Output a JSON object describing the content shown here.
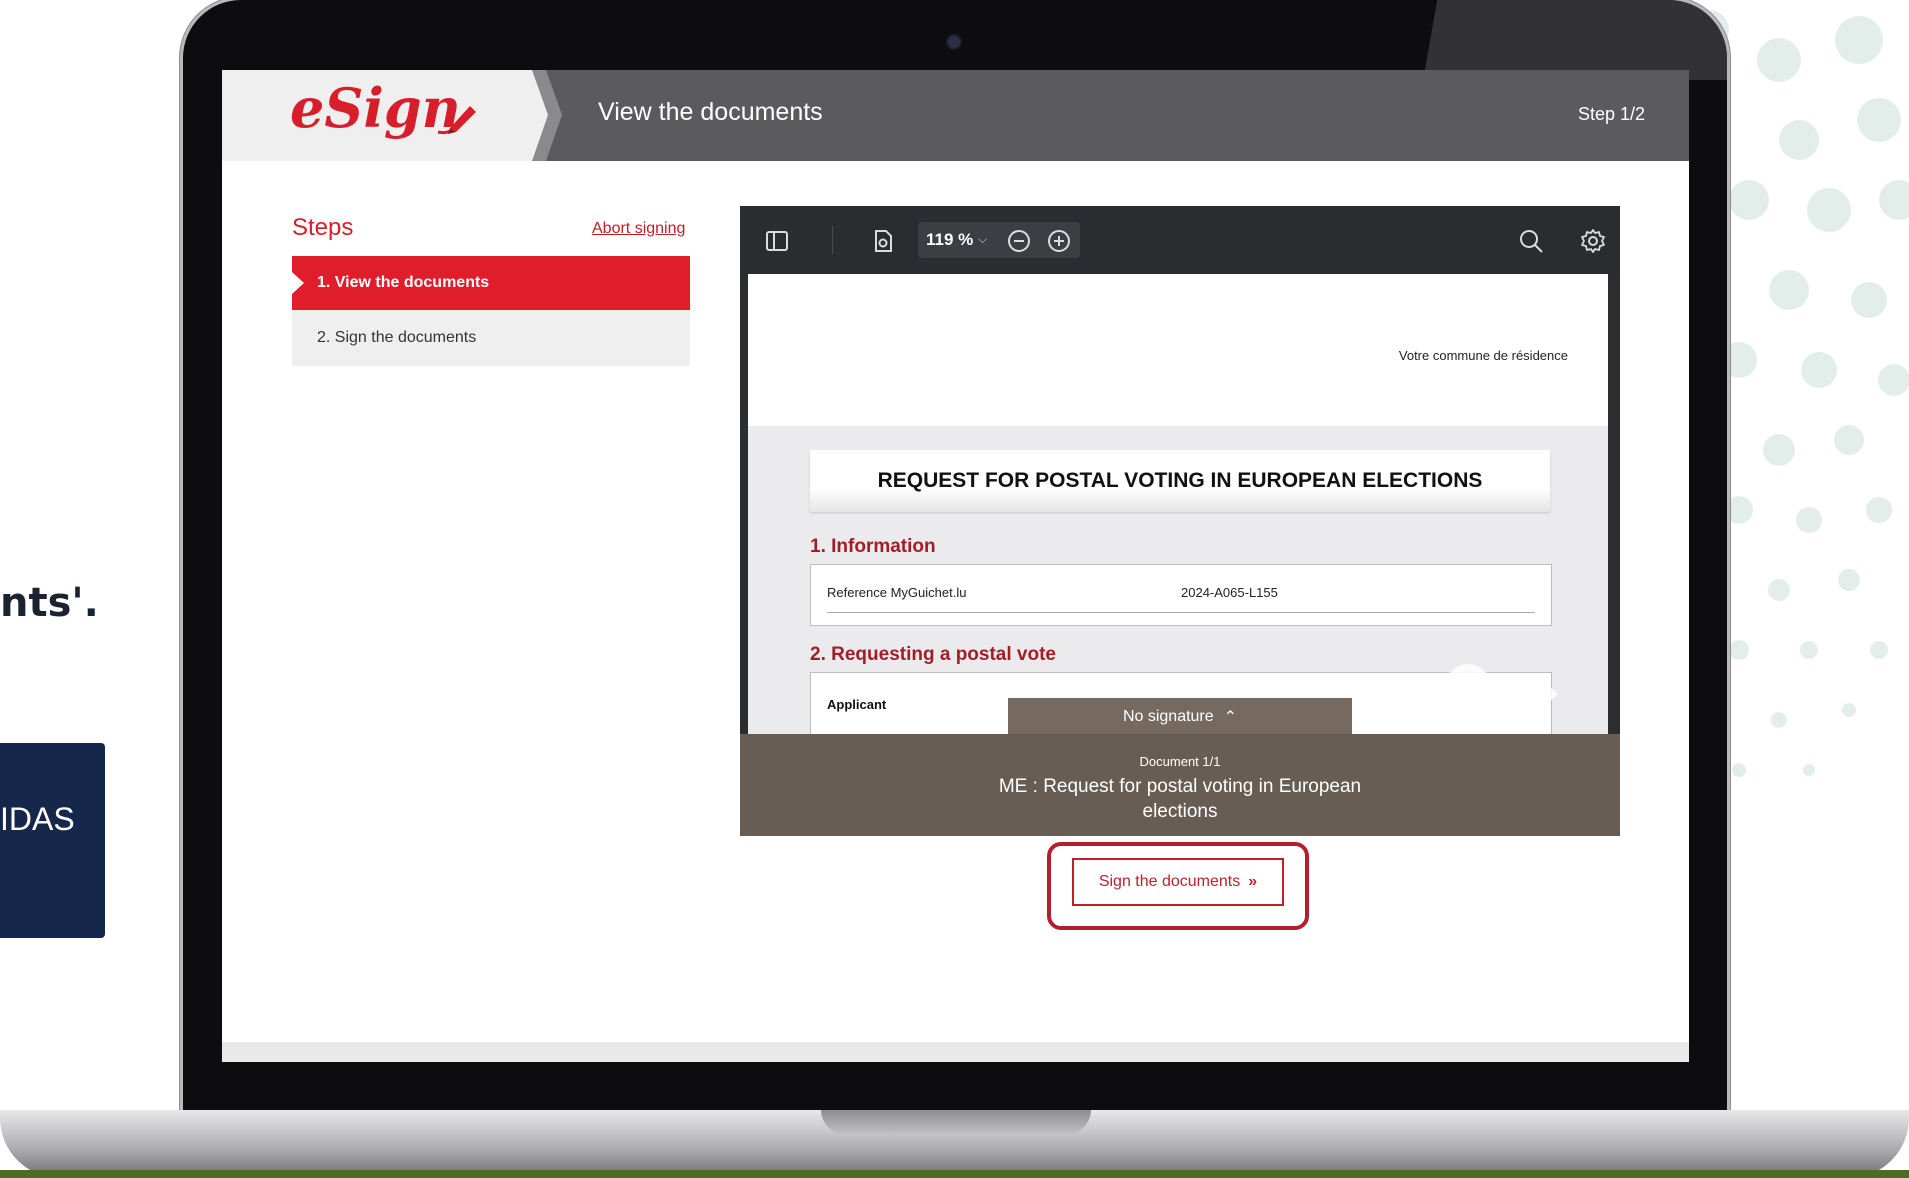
{
  "background": {
    "left_text_fragment": "nts'.",
    "left_card_fragment": "IDAS"
  },
  "header": {
    "logo_text_e": "e",
    "logo_text_sign": "Sign",
    "title": "View the documents",
    "step_indicator": "Step 1/2"
  },
  "sidebar": {
    "heading": "Steps",
    "abort_label": "Abort signing",
    "steps": [
      {
        "label": "1. View the documents",
        "active": true
      },
      {
        "label": "2. Sign the documents",
        "active": false
      }
    ]
  },
  "viewer": {
    "zoom": "119 %",
    "page": {
      "commune": "Votre commune de résidence",
      "title": "REQUEST FOR POSTAL VOTING IN EUROPEAN ELECTIONS",
      "section1": "1. Information",
      "reference_label": "Reference MyGuichet.lu",
      "reference_value": "2024-A065-L155",
      "section2": "2. Requesting a postal vote",
      "applicant_label": "Applicant"
    },
    "no_signature_label": "No signature",
    "document_count": "Document 1/1",
    "document_name": "ME : Request for postal voting in European elections"
  },
  "actions": {
    "sign_label": "Sign the documents"
  },
  "colors": {
    "brand_red": "#e01d2b",
    "header_gray": "#5b5b5e",
    "viewer_dark": "#2c2d31",
    "footer_brown": "#675d55"
  }
}
